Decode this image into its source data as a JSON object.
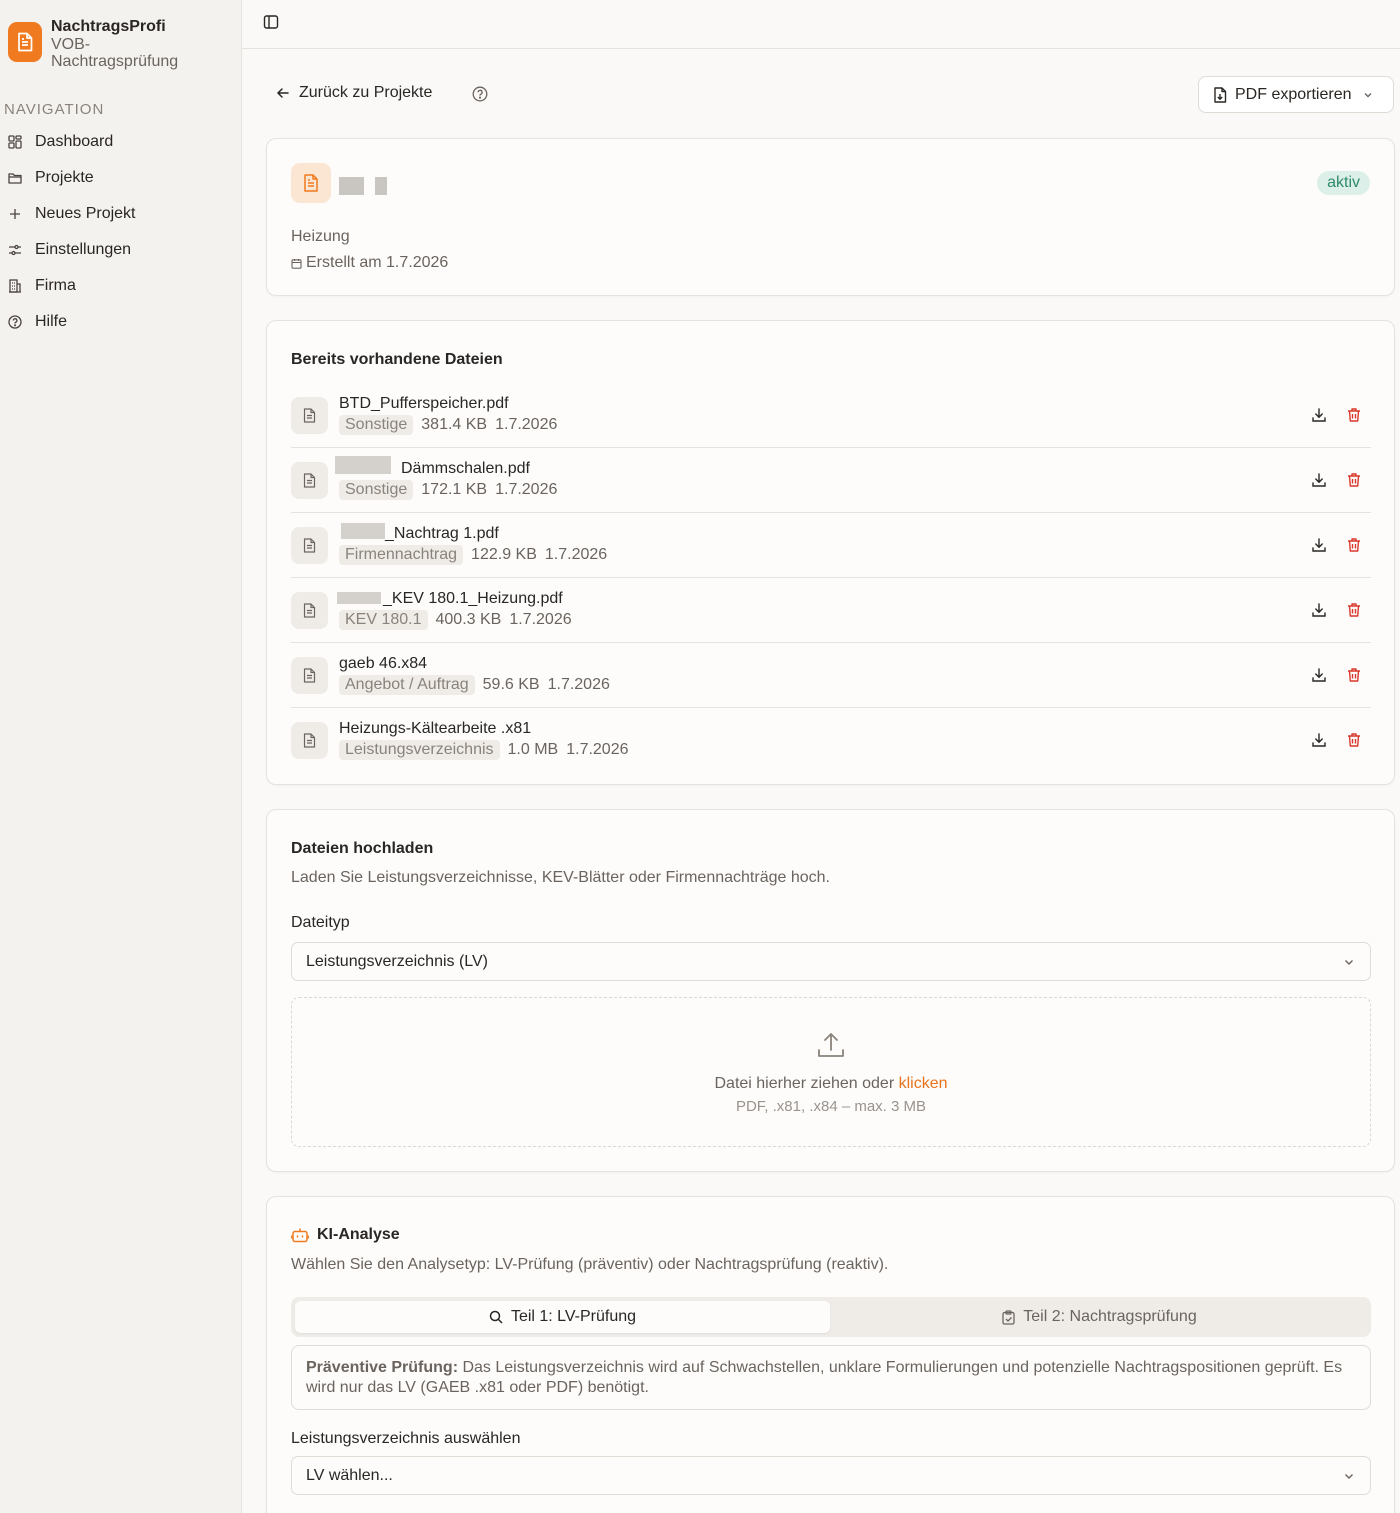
{
  "app": {
    "title": "NachtragsProfi",
    "subtitle": "VOB-Nachtragsprüfung",
    "accent": "#f07a1f"
  },
  "sidebar": {
    "heading": "NAVIGATION",
    "items": [
      {
        "label": "Dashboard",
        "icon": "dashboard-icon"
      },
      {
        "label": "Projekte",
        "icon": "folder-icon"
      },
      {
        "label": "Neues Projekt",
        "icon": "plus-icon"
      },
      {
        "label": "Einstellungen",
        "icon": "settings-icon"
      },
      {
        "label": "Firma",
        "icon": "building-icon"
      },
      {
        "label": "Hilfe",
        "icon": "help-icon"
      }
    ]
  },
  "header": {
    "back_label": "Zurück zu Projekte",
    "export_label": "PDF exportieren"
  },
  "project": {
    "status": "aktiv",
    "category": "Heizung",
    "created": "Erstellt am 1.7.2026"
  },
  "files": {
    "title": "Bereits vorhandene Dateien",
    "items": [
      {
        "name": "BTD_Pufferspeicher.pdf",
        "tag": "Sonstige",
        "size": "381.4 KB",
        "date": "1.7.2026"
      },
      {
        "name": "Dämmschalen.pdf",
        "tag": "Sonstige",
        "size": "172.1 KB",
        "date": "1.7.2026"
      },
      {
        "name": "_Nachtrag 1.pdf",
        "tag": "Firmennachtrag",
        "size": "122.9 KB",
        "date": "1.7.2026"
      },
      {
        "name": "_KEV 180.1_Heizung.pdf",
        "tag": "KEV 180.1",
        "size": "400.3 KB",
        "date": "1.7.2026"
      },
      {
        "name": "gaeb 46.x84",
        "tag": "Angebot / Auftrag",
        "size": "59.6 KB",
        "date": "1.7.2026"
      },
      {
        "name": "Heizungs-Kältearbeite .x81",
        "tag": "Leistungsverzeichnis",
        "size": "1.0 MB",
        "date": "1.7.2026"
      }
    ]
  },
  "upload": {
    "title": "Dateien hochladen",
    "description": "Laden Sie Leistungsverzeichnisse, KEV-Blätter oder Firmennachträge hoch.",
    "type_label": "Dateityp",
    "type_value": "Leistungsverzeichnis (LV)",
    "drop_text": "Datei hierher ziehen oder",
    "drop_link": "klicken",
    "drop_hint": "PDF, .x81, .x84 – max. 3 MB"
  },
  "analysis": {
    "title": "KI-Analyse",
    "description": "Wählen Sie den Analysetyp: LV-Prüfung (präventiv) oder Nachtragsprüfung (reaktiv).",
    "tab1": "Teil 1: LV-Prüfung",
    "tab2": "Teil 2: Nachtragsprüfung",
    "info_bold": "Präventive Prüfung:",
    "info_text": " Das Leistungsverzeichnis wird auf Schwachstellen, unklare Formulierungen und potenzielle Nachtragspositionen geprüft. Es wird nur das LV (GAEB .x81 oder PDF) benötigt.",
    "lv_label": "Leistungsverzeichnis auswählen",
    "lv_placeholder": "LV wählen..."
  }
}
